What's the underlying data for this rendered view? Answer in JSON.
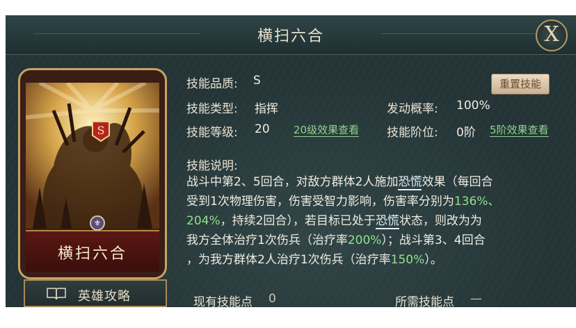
{
  "title": "横扫六合",
  "close_label": "X",
  "card": {
    "grade_badge": "S",
    "name": "横扫六合"
  },
  "guide_button": {
    "label": "英雄攻略",
    "icon": "book-icon"
  },
  "reset_button": "重置技能",
  "fields": {
    "quality": {
      "label": "技能品质:",
      "value": "S"
    },
    "type": {
      "label": "技能类型:",
      "value": "指挥"
    },
    "trigger": {
      "label": "发动概率:",
      "value": "100%"
    },
    "level": {
      "label": "技能等级:",
      "value": "20",
      "link": "20级效果查看"
    },
    "tier": {
      "label": "技能阶位:",
      "value": "0阶",
      "link": "5阶效果查看"
    }
  },
  "description": {
    "heading": "技能说明:",
    "lines": [
      [
        "战斗中第2、5回合，对敌方群体2人施加",
        "恐慌",
        "效果（每回合"
      ],
      [
        "受到1次物理伤害，伤害受智力影响，伤害率分别为",
        "136%、"
      ],
      [
        "204%",
        "，持续2回合），若目标已处于",
        "恐慌",
        "状态，则改为为"
      ],
      [
        "我方全体治疗1次伤兵（治疗率",
        "200%",
        "）；战斗第3、4回合"
      ],
      [
        "，为我方群体2人治疗1次伤兵（治疗率",
        "150%",
        "）。"
      ]
    ]
  },
  "footer": {
    "current_points_label": "现有技能点",
    "current_points_value": "0",
    "required_points_label": "所需技能点",
    "required_points_value": "—"
  },
  "colors": {
    "accent_green": "#8fe28f",
    "panel_bg": "#243436",
    "card_border": "#c9a561"
  }
}
